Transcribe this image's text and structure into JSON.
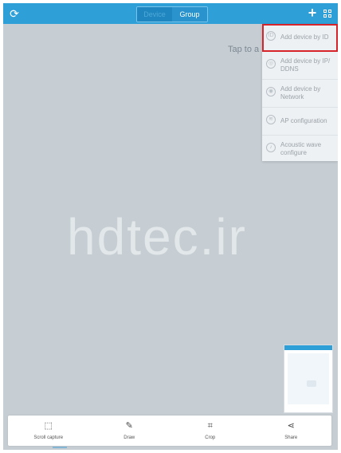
{
  "topbar": {
    "tabs": [
      {
        "label": "Device",
        "active": true
      },
      {
        "label": "Group",
        "active": false
      }
    ],
    "icons": {
      "refresh": "refresh-icon",
      "add": "plus-icon",
      "layout": "grid-icon"
    }
  },
  "main": {
    "hint_text": "Tap to a",
    "watermark_text": "hdtec.ir"
  },
  "menu": {
    "items": [
      {
        "label": "Add device by ID",
        "icon": "id-icon"
      },
      {
        "label": "Add device by IP/ DDNS",
        "icon": "ip-icon"
      },
      {
        "label": "Add device by Network",
        "icon": "network-icon"
      },
      {
        "label": "AP configuration",
        "icon": "ap-icon"
      },
      {
        "label": "Acoustic wave configure",
        "icon": "acoustic-wave-icon"
      }
    ]
  },
  "toolbar": {
    "items": [
      {
        "label": "Scroll capture",
        "icon": "scroll-capture-icon"
      },
      {
        "label": "Draw",
        "icon": "draw-icon"
      },
      {
        "label": "Crop",
        "icon": "crop-icon"
      },
      {
        "label": "Share",
        "icon": "share-icon"
      }
    ]
  },
  "colors": {
    "accent": "#2f9fd8",
    "highlight": "#d7232a",
    "background": "#c6ced4"
  }
}
